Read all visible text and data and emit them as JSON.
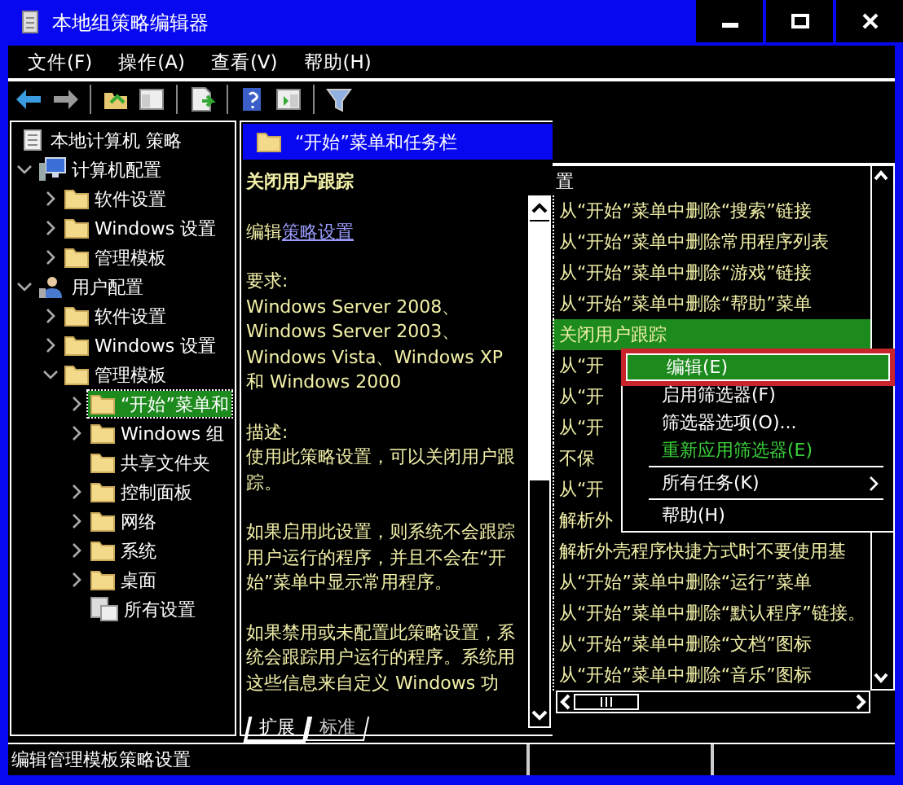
{
  "window": {
    "title": "本地组策略编辑器"
  },
  "menu_bar": [
    {
      "label": "文件(F)"
    },
    {
      "label": "操作(A)"
    },
    {
      "label": "查看(V)"
    },
    {
      "label": "帮助(H)"
    }
  ],
  "tree": [
    {
      "label": "本地计算机 策略",
      "kind": "policy",
      "selected": false,
      "children": [
        {
          "label": "计算机配置",
          "kind": "computer",
          "expanded": true,
          "selected": false,
          "children": [
            {
              "label": "软件设置",
              "kind": "folder",
              "expanded": false,
              "selected": false
            },
            {
              "label": "Windows 设置",
              "kind": "folder",
              "expanded": false,
              "selected": false
            },
            {
              "label": "管理模板",
              "kind": "folder",
              "expanded": false,
              "selected": false
            }
          ]
        },
        {
          "label": "用户配置",
          "kind": "user",
          "expanded": true,
          "selected": false,
          "children": [
            {
              "label": "软件设置",
              "kind": "folder",
              "expanded": false,
              "selected": false
            },
            {
              "label": "Windows 设置",
              "kind": "folder",
              "expanded": false,
              "selected": false
            },
            {
              "label": "管理模板",
              "kind": "folder",
              "expanded": true,
              "selected": false,
              "children": [
                {
                  "label": "“开始”菜单和",
                  "kind": "folder",
                  "expanded": false,
                  "selected": true
                },
                {
                  "label": "Windows 组",
                  "kind": "folder",
                  "expanded": false,
                  "selected": false
                },
                {
                  "label": "共享文件夹",
                  "kind": "folder",
                  "selected": false
                },
                {
                  "label": "控制面板",
                  "kind": "folder",
                  "expanded": false,
                  "selected": false
                },
                {
                  "label": "网络",
                  "kind": "folder",
                  "expanded": false,
                  "selected": false
                },
                {
                  "label": "系统",
                  "kind": "folder",
                  "expanded": false,
                  "selected": false
                },
                {
                  "label": "桌面",
                  "kind": "folder",
                  "expanded": false,
                  "selected": false
                },
                {
                  "label": "所有设置",
                  "kind": "settings",
                  "selected": false
                }
              ]
            }
          ]
        }
      ]
    }
  ],
  "details": {
    "header": "“开始”菜单和任务栏",
    "setting_title": "关闭用户跟踪",
    "edit_prefix": "编辑",
    "edit_link": "策略设置",
    "paragraphs": [
      "要求:\nWindows Server 2008、\nWindows Server 2003、\nWindows Vista、Windows XP\n和 Windows 2000",
      "描述:\n使用此策略设置，可以关闭用户跟踪。",
      "如果启用此设置，则系统不会跟踪用户运行的程序，并且不会在“开始”菜单中显示常用程序。",
      "如果禁用或未配置此策略设置，系统会跟踪用户运行的程序。系统用这些信息来自定义 Windows 功"
    ]
  },
  "settings_list": {
    "column_1": "置",
    "rows": [
      {
        "text": "从“开始”菜单中删除“搜索”链接",
        "selected": false
      },
      {
        "text": "从“开始”菜单中删除常用程序列表",
        "selected": false
      },
      {
        "text": "从“开始”菜单中删除“游戏”链接",
        "selected": false
      },
      {
        "text": "从“开始”菜单中删除“帮助”菜单",
        "selected": false
      },
      {
        "text": "关闭用户跟踪",
        "selected": true
      },
      {
        "text": "从“开",
        "selected": false
      },
      {
        "text": "从“开",
        "selected": false
      },
      {
        "text": "从“开",
        "selected": false
      },
      {
        "text": "不保",
        "selected": false
      },
      {
        "text": "从“开",
        "selected": false
      },
      {
        "text": "解析外",
        "selected": false
      },
      {
        "text": "解析外壳程序快捷方式时不要使用基",
        "selected": false
      },
      {
        "text": "从“开始”菜单中删除“运行”菜单",
        "selected": false
      },
      {
        "text": "从“开始”菜单中删除“默认程序”链接。",
        "selected": false
      },
      {
        "text": "从“开始”菜单中删除“文档”图标",
        "selected": false
      },
      {
        "text": "从“开始”菜单中删除“音乐”图标",
        "selected": false
      }
    ]
  },
  "context_menu": [
    {
      "kind": "item",
      "label": "编辑(E)",
      "highlighted": true,
      "disabled": false
    },
    {
      "kind": "item",
      "label": "启用筛选器(F)",
      "highlighted": false,
      "disabled": false
    },
    {
      "kind": "item",
      "label": "筛选器选项(O)...",
      "highlighted": false,
      "disabled": false
    },
    {
      "kind": "item",
      "label": "重新应用筛选器(E)",
      "highlighted": false,
      "disabled": true
    },
    {
      "kind": "separator"
    },
    {
      "kind": "submenu",
      "label": "所有任务(K)",
      "highlighted": false,
      "disabled": false
    },
    {
      "kind": "separator"
    },
    {
      "kind": "item",
      "label": "帮助(H)",
      "highlighted": false,
      "disabled": false
    }
  ],
  "tabs": [
    {
      "label": "扩展",
      "selected": true
    },
    {
      "label": "标准",
      "selected": false
    }
  ],
  "status_bar": {
    "text": "编辑管理模板策略设置"
  }
}
